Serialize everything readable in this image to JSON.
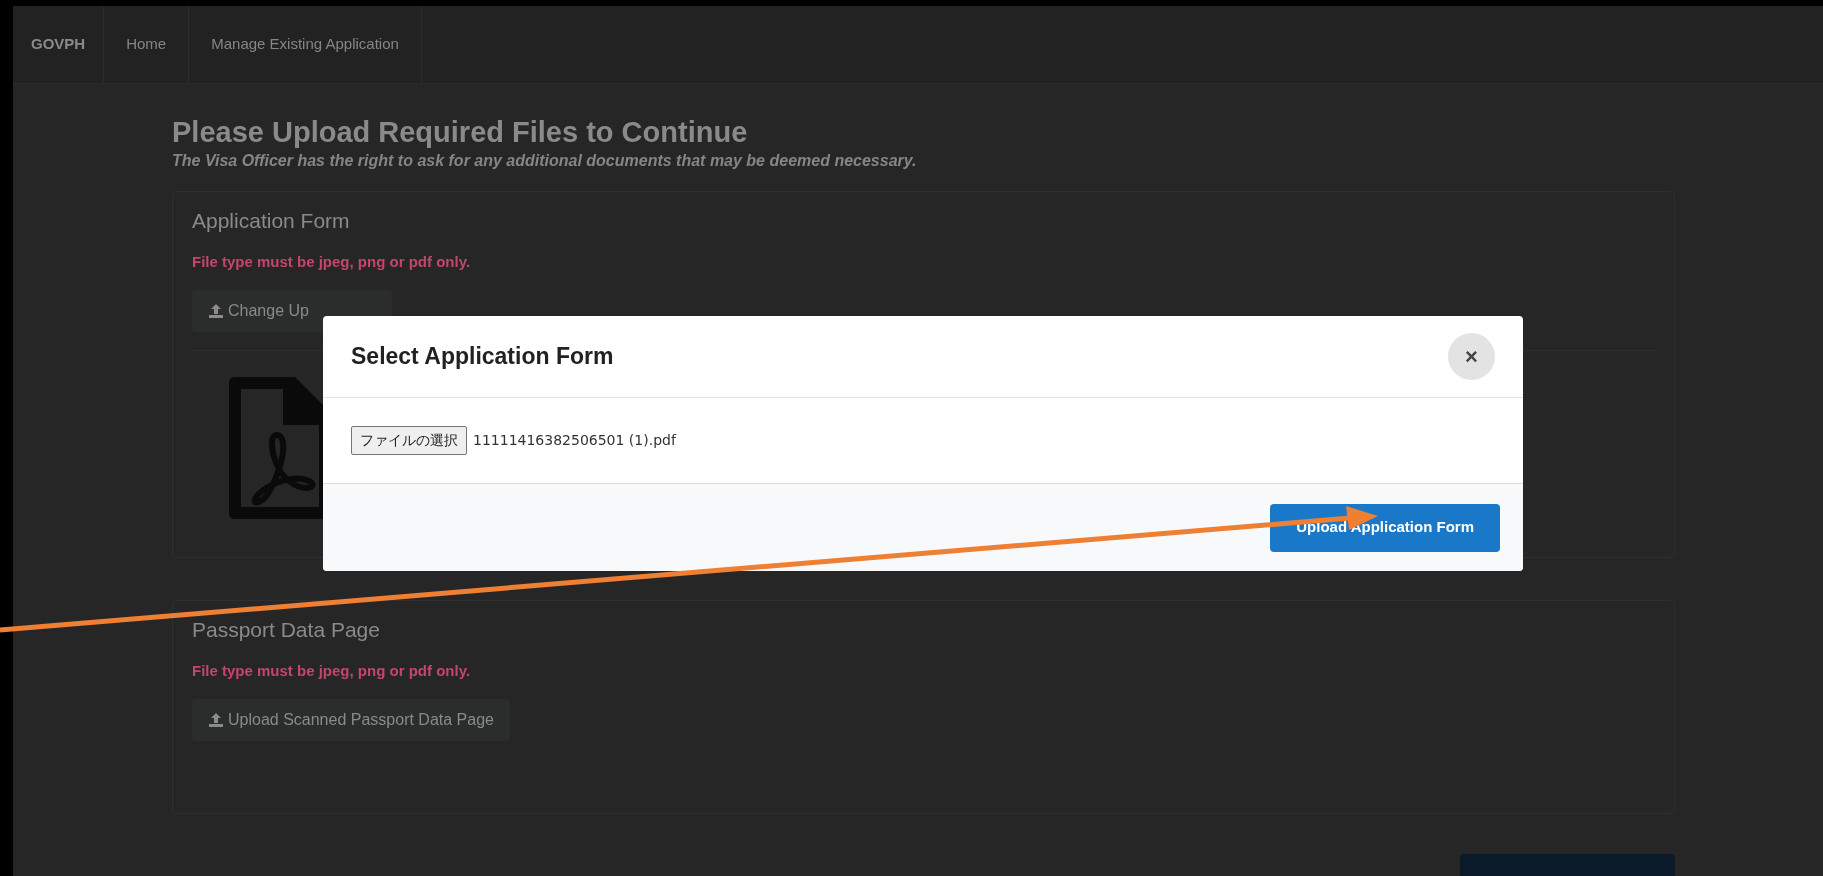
{
  "navbar": {
    "brand": "GOVPH",
    "items": [
      {
        "label": "Home"
      },
      {
        "label": "Manage Existing Application"
      }
    ]
  },
  "page": {
    "title": "Please Upload Required Files to Continue",
    "subtitle": "The Visa Officer has the right to ask for any additional documents that may be deemed necessary."
  },
  "sections": [
    {
      "title": "Application Form",
      "note": "File type must be jpeg, png or pdf only.",
      "button": "Change Up",
      "preview": {
        "kind": "pdf"
      }
    },
    {
      "title": "Passport Data Page",
      "note": "File type must be jpeg, png or pdf only.",
      "button": "Upload Scanned Passport Data Page"
    }
  ],
  "modal": {
    "title": "Select Application Form",
    "close": "×",
    "file_button": "ファイルの選択",
    "file_name": "11111416382506501 (1).pdf",
    "submit": "Upload Application Form"
  }
}
